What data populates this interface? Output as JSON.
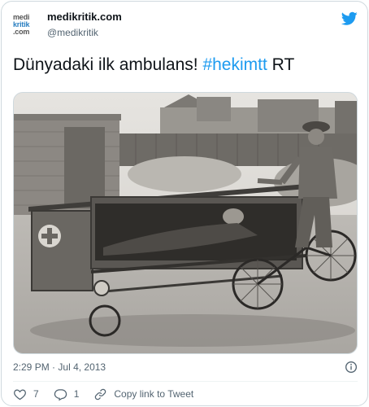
{
  "tweet": {
    "avatar": {
      "line1": "medi",
      "line2": "kritik",
      "line3": ".com"
    },
    "display_name": "medikritik.com",
    "handle": "@medikritik",
    "text_plain": "Dünyadaki ilk ambulans! ",
    "hashtag": "#hekimtt",
    "text_suffix": " RT",
    "time": "2:29 PM",
    "separator": "·",
    "date": "Jul 4, 2013",
    "likes": "7",
    "replies": "1",
    "copy_link_label": "Copy link to Tweet"
  },
  "icons": {
    "brand": "twitter-bird-icon",
    "info": "info-icon",
    "like": "heart-icon",
    "reply": "reply-icon",
    "link": "link-icon"
  },
  "colors": {
    "accent": "#1d9bf0",
    "text": "#0f1419",
    "muted": "#536471",
    "border": "#cfd9de",
    "like_red": "#f91880"
  }
}
